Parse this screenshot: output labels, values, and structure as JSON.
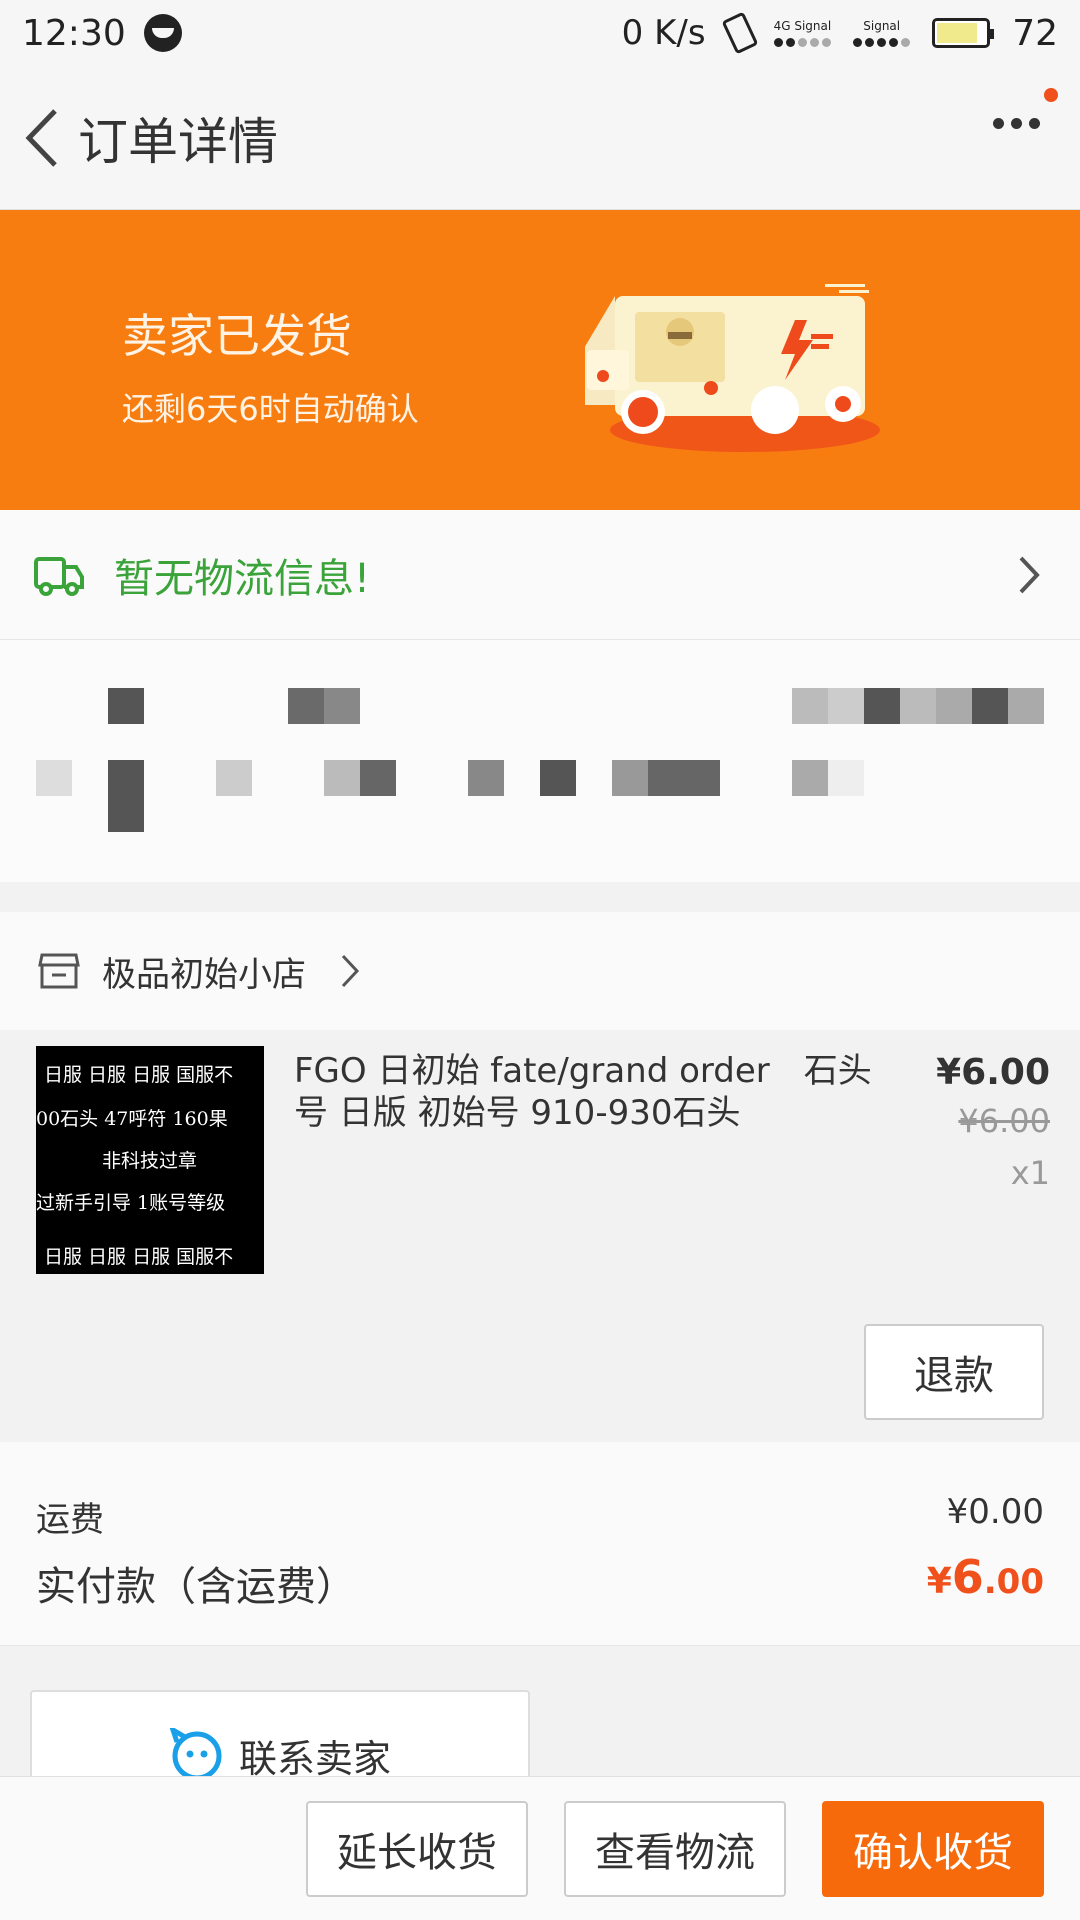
{
  "status_bar": {
    "time": "12:30",
    "net_speed": "0 K/s",
    "sim1_label": "4G Signal",
    "sim2_label": "Signal",
    "battery": "72"
  },
  "nav": {
    "title": "订单详情"
  },
  "banner": {
    "status": "卖家已发货",
    "countdown": "还剩6天6时自动确认"
  },
  "logistics": {
    "text": "暂无物流信息!"
  },
  "shop": {
    "name": "极品初始小店"
  },
  "product": {
    "title": "FGO 日初始 fate/grand order　石头号 日版 初始号 910-930石头",
    "price": "¥6.00",
    "original_price": "¥6.00",
    "quantity": "x1",
    "thumb_lines": [
      "日服 日服 日服 国服不",
      "00石头 47呼符 160果",
      "非科技过章",
      "过新手引导 1账号等级",
      "日服 日服 日服 国服不"
    ],
    "refund_label": "退款"
  },
  "totals": {
    "shipping_label": "运费",
    "shipping_value": "¥0.00",
    "paid_label": "实付款（含运费）",
    "paid_currency": "¥",
    "paid_int": "6",
    "paid_dec": ".00"
  },
  "contact": {
    "label": "联系卖家"
  },
  "actions": {
    "extend": "延长收货",
    "logistics": "查看物流",
    "confirm": "确认收货"
  },
  "colors": {
    "accent": "#f77d10",
    "price_red": "#f0501c",
    "logistics_green": "#3aa33a"
  }
}
